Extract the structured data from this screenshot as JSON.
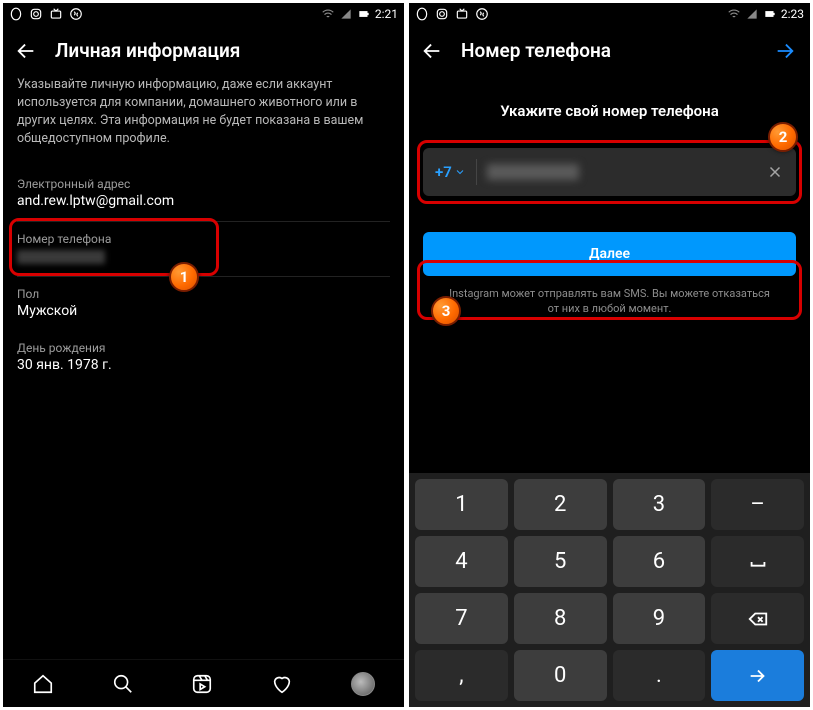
{
  "left": {
    "status_time": "2:21",
    "title": "Личная информация",
    "description": "Указывайте личную информацию, даже если аккаунт используется для компании, домашнего животного или в других целях. Эта информация не будет показана в вашем общедоступном профиле.",
    "email_label": "Электронный адрес",
    "email_value": "and.rew.lptw@gmail.com",
    "phone_label": "Номер телефона",
    "gender_label": "Пол",
    "gender_value": "Мужской",
    "birthday_label": "День рождения",
    "birthday_value": "30 янв. 1978 г."
  },
  "right": {
    "status_time": "2:23",
    "title": "Номер телефона",
    "heading": "Укажите свой номер телефона",
    "country_code": "+7",
    "next_label": "Далее",
    "hint": "Instagram может отправлять вам SMS. Вы можете отказаться от них в любой момент.",
    "keys": [
      "1",
      "2",
      "3",
      "4",
      "5",
      "6",
      "7",
      "8",
      "9",
      "0",
      ",",
      "."
    ]
  },
  "bubbles": {
    "one": "1",
    "two": "2",
    "three": "3"
  }
}
